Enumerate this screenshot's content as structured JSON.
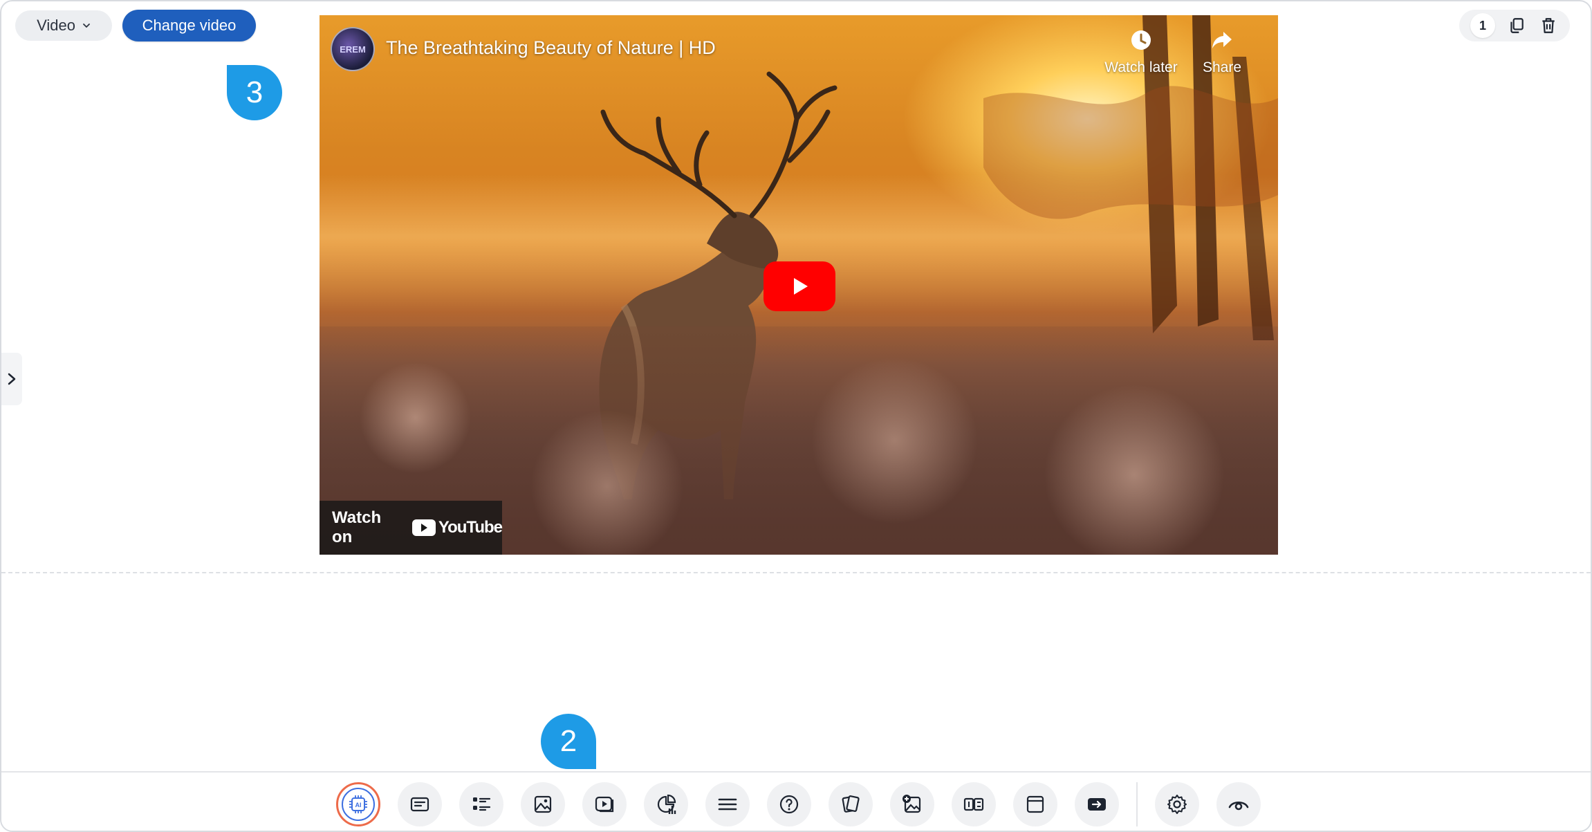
{
  "block_type": {
    "label": "Video"
  },
  "change_video": {
    "label": "Change video"
  },
  "callouts": {
    "step3": "3",
    "step2": "2"
  },
  "top_right": {
    "page_count": "1"
  },
  "video": {
    "channel_avatar_text": "EREM",
    "title": "The Breathtaking Beauty of Nature | HD",
    "watch_later": "Watch later",
    "share": "Share",
    "watch_on": "Watch on",
    "youtube": "YouTube"
  },
  "toolbar": {
    "items": [
      "ai-icon",
      "text-block-icon",
      "list-icon",
      "image-icon",
      "video-icon",
      "chart-icon",
      "divider-lines-icon",
      "question-icon",
      "flashcards-icon",
      "image-hotspot-icon",
      "compare-icon",
      "frame-icon",
      "embed-icon",
      "settings-icon",
      "preview-icon"
    ]
  },
  "colors": {
    "primary": "#1f5fbd",
    "callout": "#1e9be6",
    "youtube_red": "#ff0000",
    "ai_ring": "#ed6b4a"
  }
}
